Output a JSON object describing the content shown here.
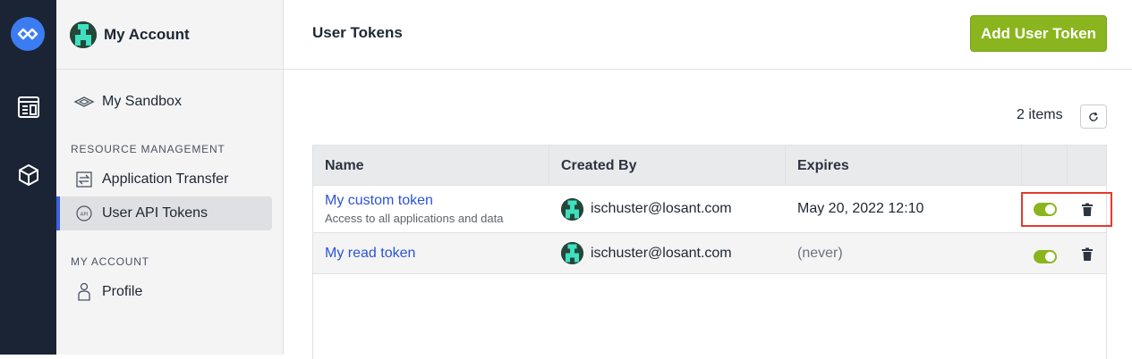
{
  "sidebar": {
    "title": "My Account",
    "sandbox_label": "My Sandbox",
    "section_resource": "RESOURCE MANAGEMENT",
    "item_transfer": "Application Transfer",
    "item_tokens": "User API Tokens",
    "section_account": "MY ACCOUNT",
    "item_profile": "Profile"
  },
  "header": {
    "title": "User Tokens",
    "add_button": "Add User Token"
  },
  "list": {
    "count": "2 items"
  },
  "table": {
    "columns": [
      "Name",
      "Created By",
      "Expires"
    ],
    "rows": [
      {
        "name": "My custom token",
        "description": "Access to all applications and data",
        "created_by": "ischuster@losant.com",
        "expires": "May 20, 2022 12:10",
        "enabled": true
      },
      {
        "name": "My read token",
        "description": "",
        "created_by": "ischuster@losant.com",
        "expires": "(never)",
        "enabled": true
      }
    ]
  },
  "colors": {
    "accent_green": "#8ab51e",
    "link_blue": "#2d53d6",
    "highlight_red": "#e23b2e",
    "rail_dark": "#1b2434"
  }
}
